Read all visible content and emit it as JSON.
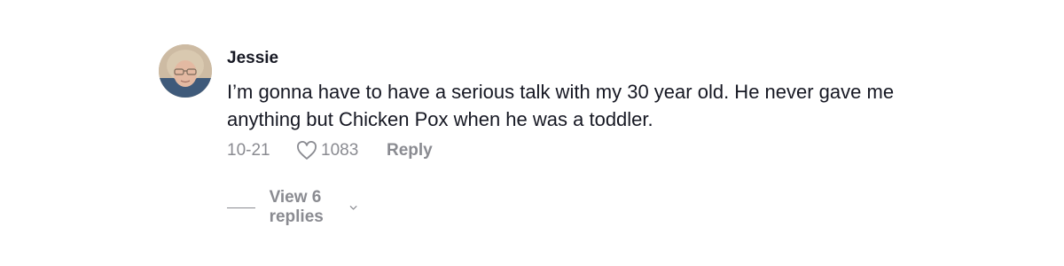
{
  "comment": {
    "username": "Jessie",
    "text": "I’m gonna have to have a serious talk with my 30 year old. He never gave me anything but Chicken Pox when he was a toddler.",
    "date": "10-21",
    "like_count": "1083",
    "reply_label": "Reply",
    "view_replies_label": "View 6 replies"
  },
  "icons": {
    "like": "heart-outline-icon",
    "expand": "chevron-down-icon"
  },
  "colors": {
    "text_primary": "#161823",
    "text_secondary": "#8a8b91"
  }
}
